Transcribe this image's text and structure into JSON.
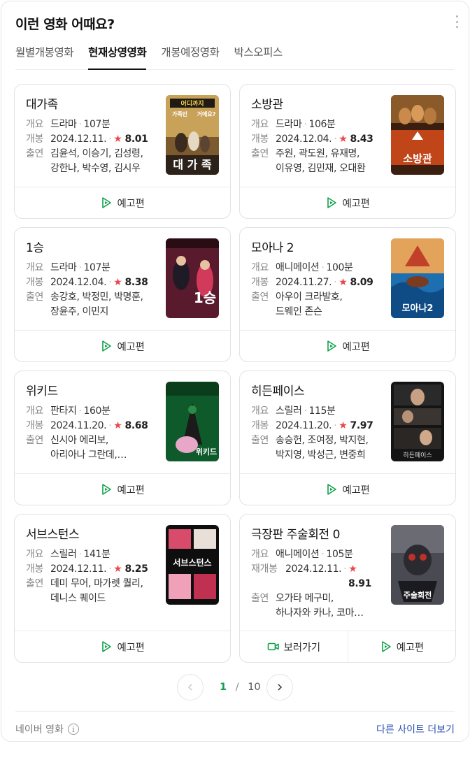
{
  "header": {
    "title": "이런 영화 어때요?"
  },
  "tabs": [
    {
      "label": "월별개봉영화",
      "active": false
    },
    {
      "label": "현재상영영화",
      "active": true
    },
    {
      "label": "개봉예정영화",
      "active": false
    },
    {
      "label": "박스오피스",
      "active": false
    }
  ],
  "labels": {
    "summary": "개요",
    "release": "개봉",
    "rerelease": "재개봉",
    "cast": "출연",
    "trailer": "예고편",
    "watch": "보러가기",
    "star": "★",
    "sep": "·"
  },
  "movies": [
    {
      "title": "대가족",
      "genre": "드라마",
      "runtime": "107분",
      "date": "2024.12.11.",
      "rating": "8.01",
      "cast1": "김윤석, 이승기, 김성령,",
      "cast2": "강한나, 박수영, 김시우"
    },
    {
      "title": "소방관",
      "genre": "드라마",
      "runtime": "106분",
      "date": "2024.12.04.",
      "rating": "8.43",
      "cast1": "주원, 곽도원, 유재명,",
      "cast2": "이유영, 김민재, 오대환"
    },
    {
      "title": "1승",
      "genre": "드라마",
      "runtime": "107분",
      "date": "2024.12.04.",
      "rating": "8.38",
      "cast1": "송강호, 박정민, 박명훈,",
      "cast2": "장윤주, 이민지"
    },
    {
      "title": "모아나 2",
      "genre": "애니메이션",
      "runtime": "100분",
      "date": "2024.11.27.",
      "rating": "8.09",
      "cast1": "아우이 크라발호,",
      "cast2": "드웨인 존슨"
    },
    {
      "title": "위키드",
      "genre": "판타지",
      "runtime": "160분",
      "date": "2024.11.20.",
      "rating": "8.68",
      "cast1": "신시아 에리보,",
      "cast2": "아리아나 그란데,…"
    },
    {
      "title": "히든페이스",
      "genre": "스릴러",
      "runtime": "115분",
      "date": "2024.11.20.",
      "rating": "7.97",
      "cast1": "송승헌, 조여정, 박지현,",
      "cast2": "박지영, 박성근, 변중희"
    },
    {
      "title": "서브스턴스",
      "genre": "스릴러",
      "runtime": "141분",
      "date": "2024.12.11.",
      "rating": "8.25",
      "cast1": "데미 무어, 마가렛 퀄리,",
      "cast2": "데니스 퀘이드"
    },
    {
      "title": "극장판 주술회전 0",
      "genre": "애니메이션",
      "runtime": "105분",
      "date": "2024.12.11.",
      "rating": "8.91",
      "cast1": "오가타 메구미,",
      "cast2": "하나자와 카나, 코마…"
    }
  ],
  "posters": {
    "p0": [
      "어디까지",
      "가족인",
      "거에요?",
      "대 가 족"
    ],
    "p1": [
      "소방관"
    ],
    "p2": [
      "1승"
    ],
    "p3": [
      "모아나2"
    ],
    "p4": [
      "위키드"
    ],
    "p5": [
      "히든페이스"
    ],
    "p6": [
      "서브스턴스"
    ],
    "p7": [
      "주술회전"
    ]
  },
  "pagination": {
    "current": "1",
    "sep": "/",
    "total": "10"
  },
  "footer": {
    "source": "네이버 영화",
    "info": "i",
    "other_link": "다른 사이트 더보기"
  },
  "colors": {
    "accent_green": "#12a14b",
    "star_red": "#e8474d",
    "link_blue": "#2a4fb4"
  }
}
